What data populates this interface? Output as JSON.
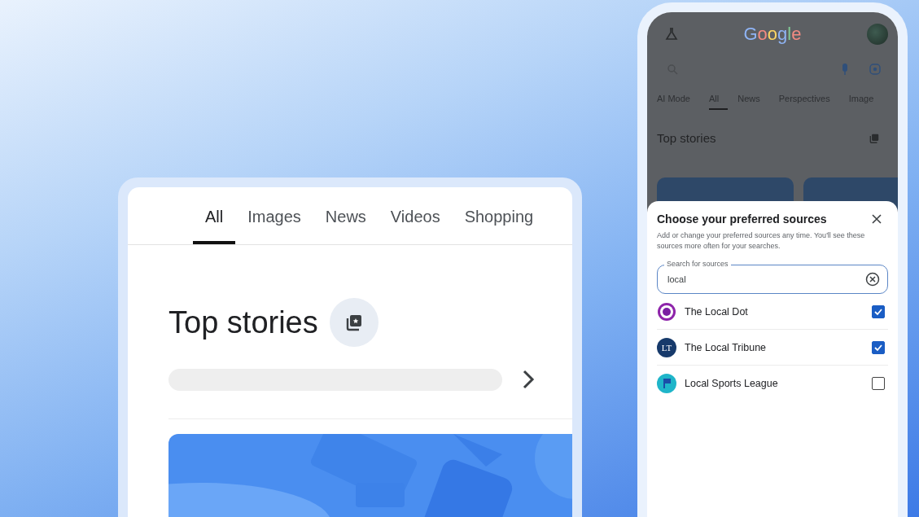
{
  "left_card": {
    "tabs": [
      {
        "label": "All",
        "selected": true
      },
      {
        "label": "Images",
        "selected": false
      },
      {
        "label": "News",
        "selected": false
      },
      {
        "label": "Videos",
        "selected": false
      },
      {
        "label": "Shopping",
        "selected": false
      }
    ],
    "section_title": "Top stories"
  },
  "phone": {
    "logo": "Google",
    "tabs": [
      {
        "label": "AI Mode",
        "selected": false
      },
      {
        "label": "All",
        "selected": true
      },
      {
        "label": "News",
        "selected": false
      },
      {
        "label": "Perspectives",
        "selected": false
      },
      {
        "label": "Image",
        "selected": false
      }
    ],
    "section_title": "Top stories",
    "sheet": {
      "title": "Choose your preferred sources",
      "description": "Add or change your preferred sources any time. You'll see these sources more often for your searches.",
      "search": {
        "label": "Search for sources",
        "value": "local"
      },
      "sources": [
        {
          "name": "The Local Dot",
          "kind": "ring",
          "checked": true
        },
        {
          "name": "The Local Tribune",
          "kind": "initials",
          "initials": "LT",
          "checked": true
        },
        {
          "name": "Local Sports League",
          "kind": "flag",
          "checked": false
        }
      ]
    }
  }
}
